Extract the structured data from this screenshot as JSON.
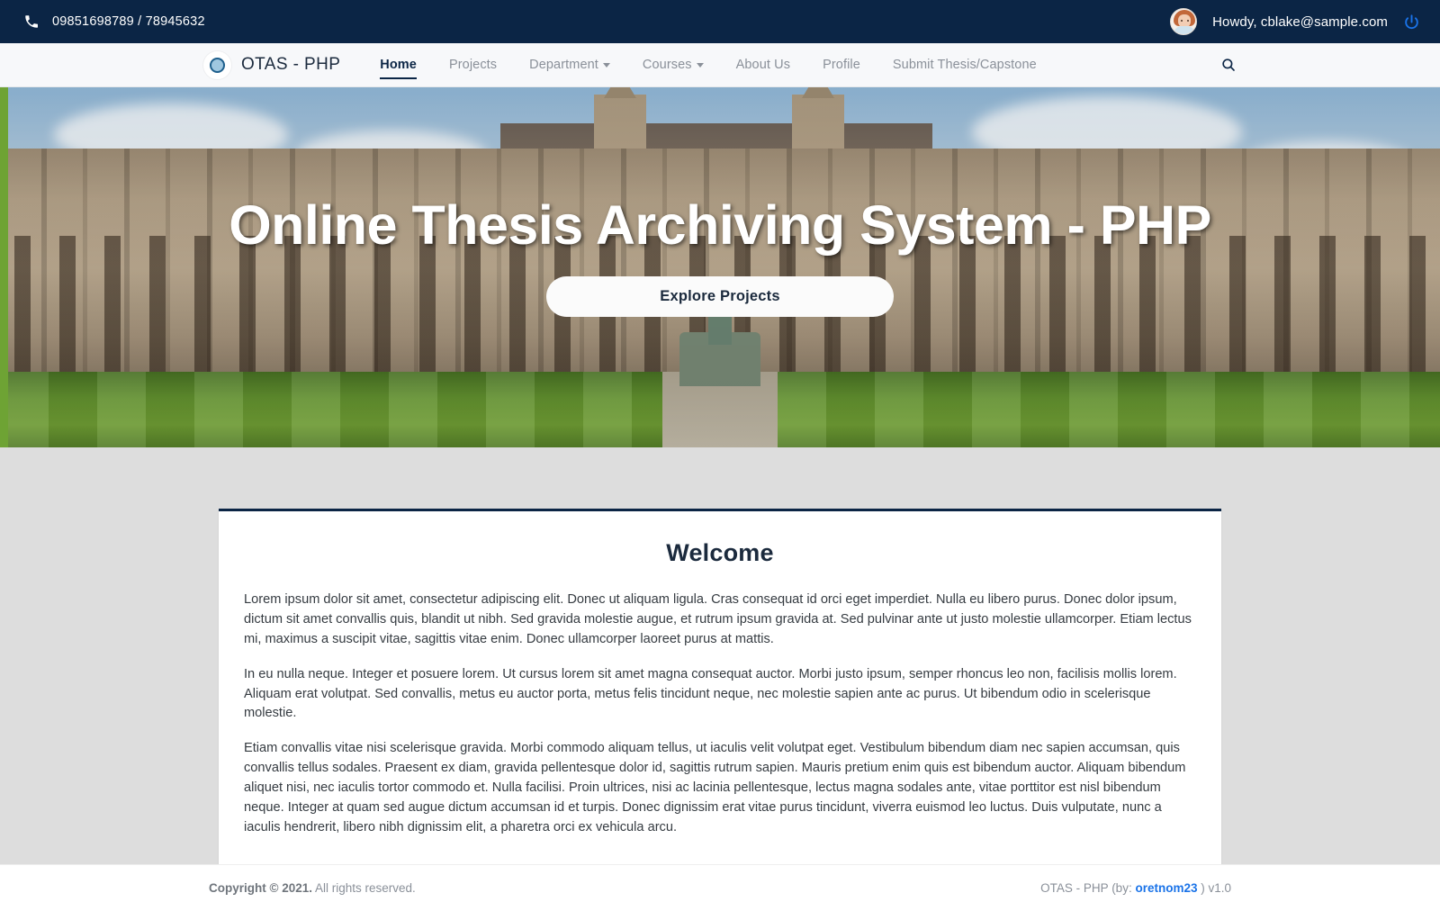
{
  "topbar": {
    "phone": "09851698789 / 78945632",
    "phone_icon": "phone-icon",
    "greeting": "Howdy, cblake@sample.com",
    "logout_icon": "power-icon",
    "avatar_label": "user-avatar",
    "bg_color": "#0b2545"
  },
  "nav": {
    "brand": "OTAS - PHP",
    "brand_icon": "circle-logo-icon",
    "search_icon": "search-icon",
    "items": [
      {
        "label": "Home",
        "active": true,
        "has_caret": false
      },
      {
        "label": "Projects",
        "active": false,
        "has_caret": false
      },
      {
        "label": "Department",
        "active": false,
        "has_caret": true
      },
      {
        "label": "Courses",
        "active": false,
        "has_caret": true
      },
      {
        "label": "About Us",
        "active": false,
        "has_caret": false
      },
      {
        "label": "Profile",
        "active": false,
        "has_caret": false
      },
      {
        "label": "Submit Thesis/Capstone",
        "active": false,
        "has_caret": false
      }
    ]
  },
  "hero": {
    "title": "Online Thesis Archiving System - PHP",
    "cta_label": "Explore Projects",
    "accent_color": "#6ea334"
  },
  "welcome": {
    "title": "Welcome",
    "paragraphs": [
      "Lorem ipsum dolor sit amet, consectetur adipiscing elit. Donec ut aliquam ligula. Cras consequat id orci eget imperdiet. Nulla eu libero purus. Donec dolor ipsum, dictum sit amet convallis quis, blandit ut nibh. Sed gravida molestie augue, et rutrum ipsum gravida at. Sed pulvinar ante ut justo molestie ullamcorper. Etiam lectus mi, maximus a suscipit vitae, sagittis vitae enim. Donec ullamcorper laoreet purus at mattis.",
      "In eu nulla neque. Integer et posuere lorem. Ut cursus lorem sit amet magna consequat auctor. Morbi justo ipsum, semper rhoncus leo non, facilisis mollis lorem. Aliquam erat volutpat. Sed convallis, metus eu auctor porta, metus felis tincidunt neque, nec molestie sapien ante ac purus. Ut bibendum odio in scelerisque molestie.",
      "Etiam convallis vitae nisi scelerisque gravida. Morbi commodo aliquam tellus, ut iaculis velit volutpat eget. Vestibulum bibendum diam nec sapien accumsan, quis convallis tellus sodales. Praesent ex diam, gravida pellentesque dolor id, sagittis rutrum sapien. Mauris pretium enim quis est bibendum auctor. Aliquam bibendum aliquet nisi, nec iaculis tortor commodo et. Nulla facilisi. Proin ultrices, nisi ac lacinia pellentesque, lectus magna sodales ante, vitae porttitor est nisl bibendum neque. Integer at quam sed augue dictum accumsan id et turpis. Donec dignissim erat vitae purus tincidunt, viverra euismod leo luctus. Duis vulputate, nunc a iaculis hendrerit, libero nibh dignissim elit, a pharetra orci ex vehicula arcu."
    ]
  },
  "footer": {
    "copyright_bold": "Copyright © 2021.",
    "copyright_rest": " All rights reserved.",
    "app_prefix": "OTAS - PHP (by: ",
    "app_author": "oretnom23",
    "app_suffix": " ) v1.0"
  }
}
